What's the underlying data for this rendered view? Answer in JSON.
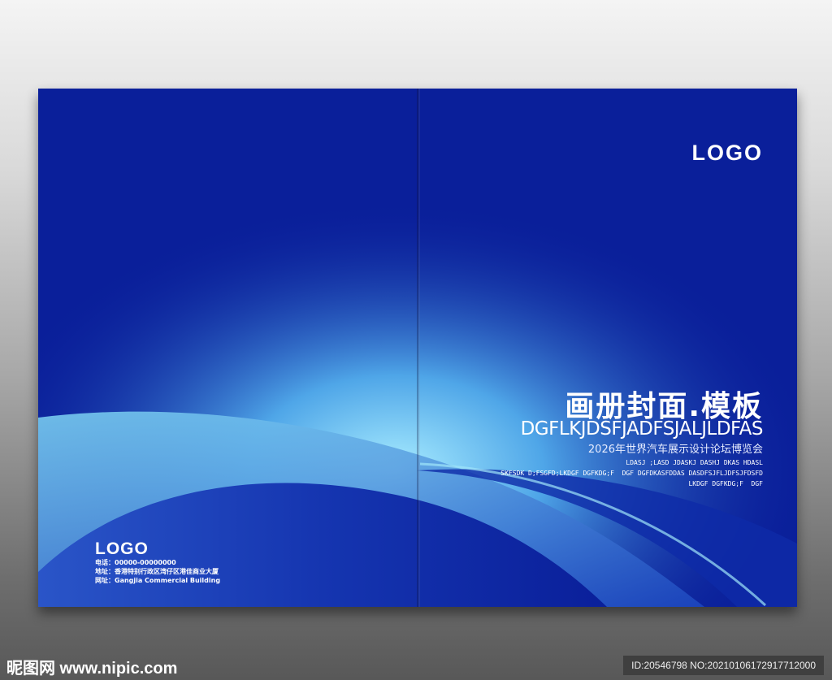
{
  "cover": {
    "right": {
      "logo": "LOGO",
      "title": "画册封面.模板",
      "subtitle_en": "DGFLKJDSFJADFSJALJLDFAS",
      "subtitle_cn": "2026年世界汽车展示设计论坛博览会",
      "small_lines": [
        "LDASJ ;LASD JDASKJ DASHJ DKAS HDASL",
        "SKFSDK D;FSGFD;LKDGF DGFKDG;F  DGF DGFDKASFDDAS DASDFSJFLJDFSJFDSFD",
        "LKDGF DGFKDG;F  DGF"
      ]
    },
    "left": {
      "logo": "LOGO",
      "phone": "电话：00000-00000000",
      "address": "地址：香港特别行政区湾仔区港佳商业大厦",
      "website": "网址：Gangjia Commercial Building"
    },
    "colors": {
      "base": "#0a1f9a",
      "light": "#8fe0f7"
    }
  },
  "footer": {
    "site": "昵图网 www.nipic.com",
    "id": "ID:20546798 NO:20210106172917712000"
  }
}
